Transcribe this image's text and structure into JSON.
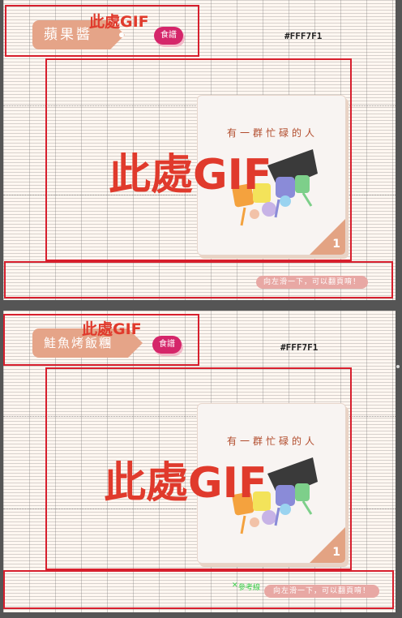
{
  "screens": [
    {
      "tag": "蘋果醬",
      "badge": "食譜",
      "header_gif": "此處GIF",
      "hex": "#FFF7F1",
      "main_gif": "此處GIF",
      "card_title": "有一群忙碌的人",
      "page_number": "1",
      "swipe_hint": "向左滑一下，可以翻頁唷！"
    },
    {
      "tag": "鮭魚烤飯糰",
      "badge": "食譜",
      "header_gif": "此處GIF",
      "hex": "#FFF7F1",
      "main_gif": "此處GIF",
      "card_title": "有一群忙碌的人",
      "page_number": "1",
      "swipe_hint": "向左滑一下，可以翻頁唷！",
      "reference_label": "參考線"
    }
  ],
  "colors": {
    "background": "#FFF7F1",
    "frame": "#d71f2d",
    "tag": "#e5a488",
    "badge": "#d5266a",
    "gif_text": "#e03a2c",
    "swipe": "#e8a8a4",
    "corner": "#e3a383"
  },
  "icons": [
    "illustration-people-icon",
    "corner-page-icon",
    "reference-cross-icon"
  ]
}
